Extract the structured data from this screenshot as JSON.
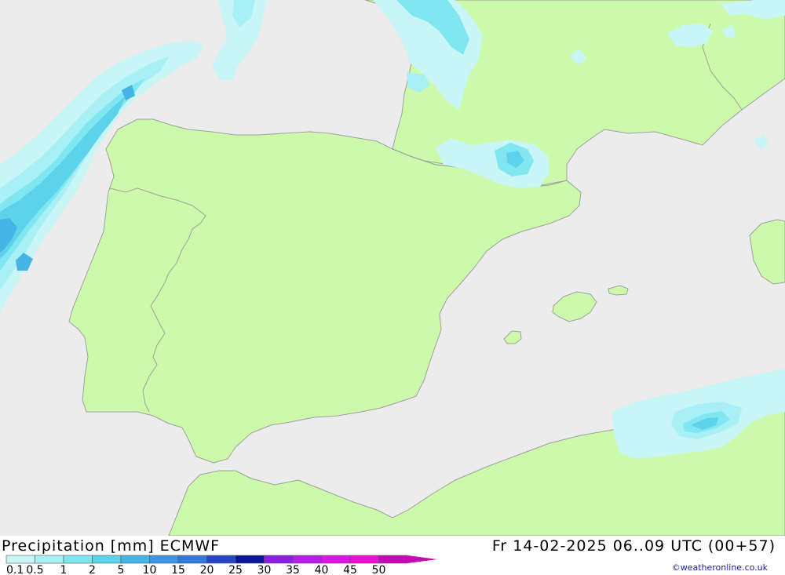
{
  "header": {
    "title": "Precipitation [mm] ECMWF",
    "datetime": "Fr 14-02-2025 06..09 UTC (00+57)",
    "credit": "©weatheronline.co.uk"
  },
  "legend": {
    "labels": [
      "0.1",
      "0.5",
      "1",
      "2",
      "5",
      "10",
      "15",
      "20",
      "25",
      "30",
      "35",
      "40",
      "45",
      "50"
    ],
    "colors": [
      "#c8f5f5",
      "#a8f0f5",
      "#80e6f0",
      "#5cd2eb",
      "#45b4e6",
      "#3c96e1",
      "#3278d7",
      "#2346c3",
      "#0a1496",
      "#8c1ee6",
      "#b41ee6",
      "#dc14e6",
      "#f00ad2",
      "#c80ab4"
    ]
  },
  "colors": {
    "sea": "#ececec",
    "land": "#ccfaaa",
    "border": "#a0a0a0"
  },
  "map_values": [
    {
      "v": "0"
    },
    {
      "v": "0"
    },
    {
      "v": "0"
    },
    {
      "v": "0"
    },
    {
      "v": "1"
    },
    {
      "v": "1"
    },
    {
      "v": "2"
    },
    {
      "v": "0"
    },
    {
      "v": "1"
    },
    {
      "v": "1"
    },
    {
      "v": "1"
    },
    {
      "v": "1"
    },
    {
      "v": "0"
    },
    {
      "v": "0"
    },
    {
      "v": "0"
    },
    {
      "v": "0"
    },
    {
      "v": "0"
    },
    {
      "v": "0"
    },
    {
      "v": "0"
    },
    {
      "v": "0"
    },
    {
      "v": "0"
    },
    {
      "v": "0"
    },
    {
      "v": "0"
    },
    {
      "v": "0"
    },
    {
      "v": "0"
    },
    {
      "v": "0"
    },
    {
      "v": "0"
    },
    {
      "v": "0"
    },
    {
      "v": "0"
    },
    {
      "v": "0"
    },
    {
      "v": "0"
    },
    {
      "v": "1"
    },
    {
      "v": "0"
    },
    {
      "v": "0"
    },
    {
      "v": "0"
    },
    {
      "v": "1"
    },
    {
      "v": "0"
    },
    {
      "v": "2"
    },
    {
      "v": "1"
    },
    {
      "v": "0"
    },
    {
      "v": "2"
    },
    {
      "v": "1"
    },
    {
      "v": "0"
    },
    {
      "v": "2"
    },
    {
      "v": "1"
    },
    {
      "v": "2"
    },
    {
      "v": "0"
    },
    {
      "v": "0"
    },
    {
      "v": "3"
    },
    {
      "v": "0"
    },
    {
      "v": "0"
    },
    {
      "v": "1"
    },
    {
      "v": "2"
    },
    {
      "v": "0"
    },
    {
      "v": "0"
    },
    {
      "v": "1"
    },
    {
      "v": "1"
    },
    {
      "v": "1"
    },
    {
      "v": "6"
    },
    {
      "v": "2"
    },
    {
      "v": "0"
    },
    {
      "v": "5"
    },
    {
      "v": "0"
    },
    {
      "v": "1"
    },
    {
      "v": "0"
    },
    {
      "v": "0"
    },
    {
      "v": "0"
    },
    {
      "v": "1"
    },
    {
      "v": "1"
    },
    {
      "v": "0"
    },
    {
      "v": "0"
    },
    {
      "v": "1"
    },
    {
      "v": "0"
    },
    {
      "v": "0"
    },
    {
      "v": "0"
    },
    {
      "v": "0"
    },
    {
      "v": "0"
    },
    {
      "v": "0"
    },
    {
      "v": "0"
    },
    {
      "v": "0"
    },
    {
      "v": "0"
    },
    {
      "v": "0"
    },
    {
      "v": "0"
    },
    {
      "v": "0"
    },
    {
      "v": "0"
    },
    {
      "v": "0"
    },
    {
      "v": "1"
    },
    {
      "v": "2"
    },
    {
      "v": "0"
    },
    {
      "v": "1"
    },
    {
      "v": "0"
    },
    {
      "v": "1"
    },
    {
      "v": "1"
    },
    {
      "v": "0"
    },
    {
      "v": "0"
    },
    {
      "v": "2"
    },
    {
      "v": "0"
    },
    {
      "v": "0"
    },
    {
      "v": "0"
    },
    {
      "v": "0"
    },
    {
      "v": "0"
    },
    {
      "v": "0"
    }
  ]
}
